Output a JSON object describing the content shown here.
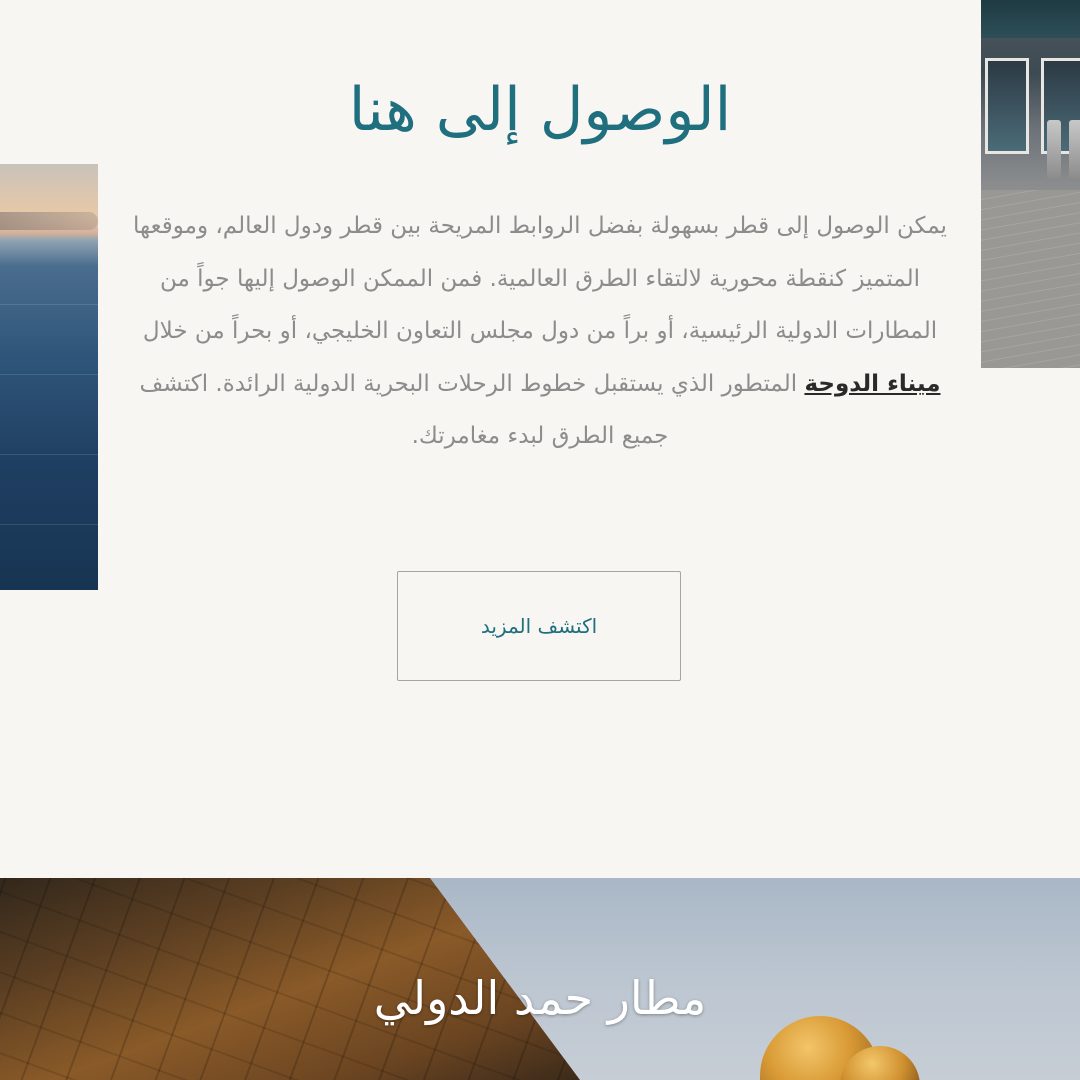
{
  "section": {
    "title": "الوصول إلى هنا",
    "description_part1": "يمكن الوصول إلى قطر بسهولة بفضل الروابط المريحة بين قطر ودول العالم، وموقعها المتميز كنقطة محورية لالتقاء الطرق العالمية. فمن الممكن الوصول إليها جواً من المطارات الدولية الرئيسية، أو براً من دول مجلس التعاون الخليجي، أو بحراً من خلال ",
    "description_link": "ميناء الدوحة",
    "description_part2": " المتطور الذي يستقبل خطوط الرحلات البحرية الدولية الرائدة. اكتشف جميع الطرق لبدء مغامرتك.",
    "more_button": "اكتشف المزيد"
  },
  "airport_banner": {
    "title": "مطار حمد الدولي"
  }
}
